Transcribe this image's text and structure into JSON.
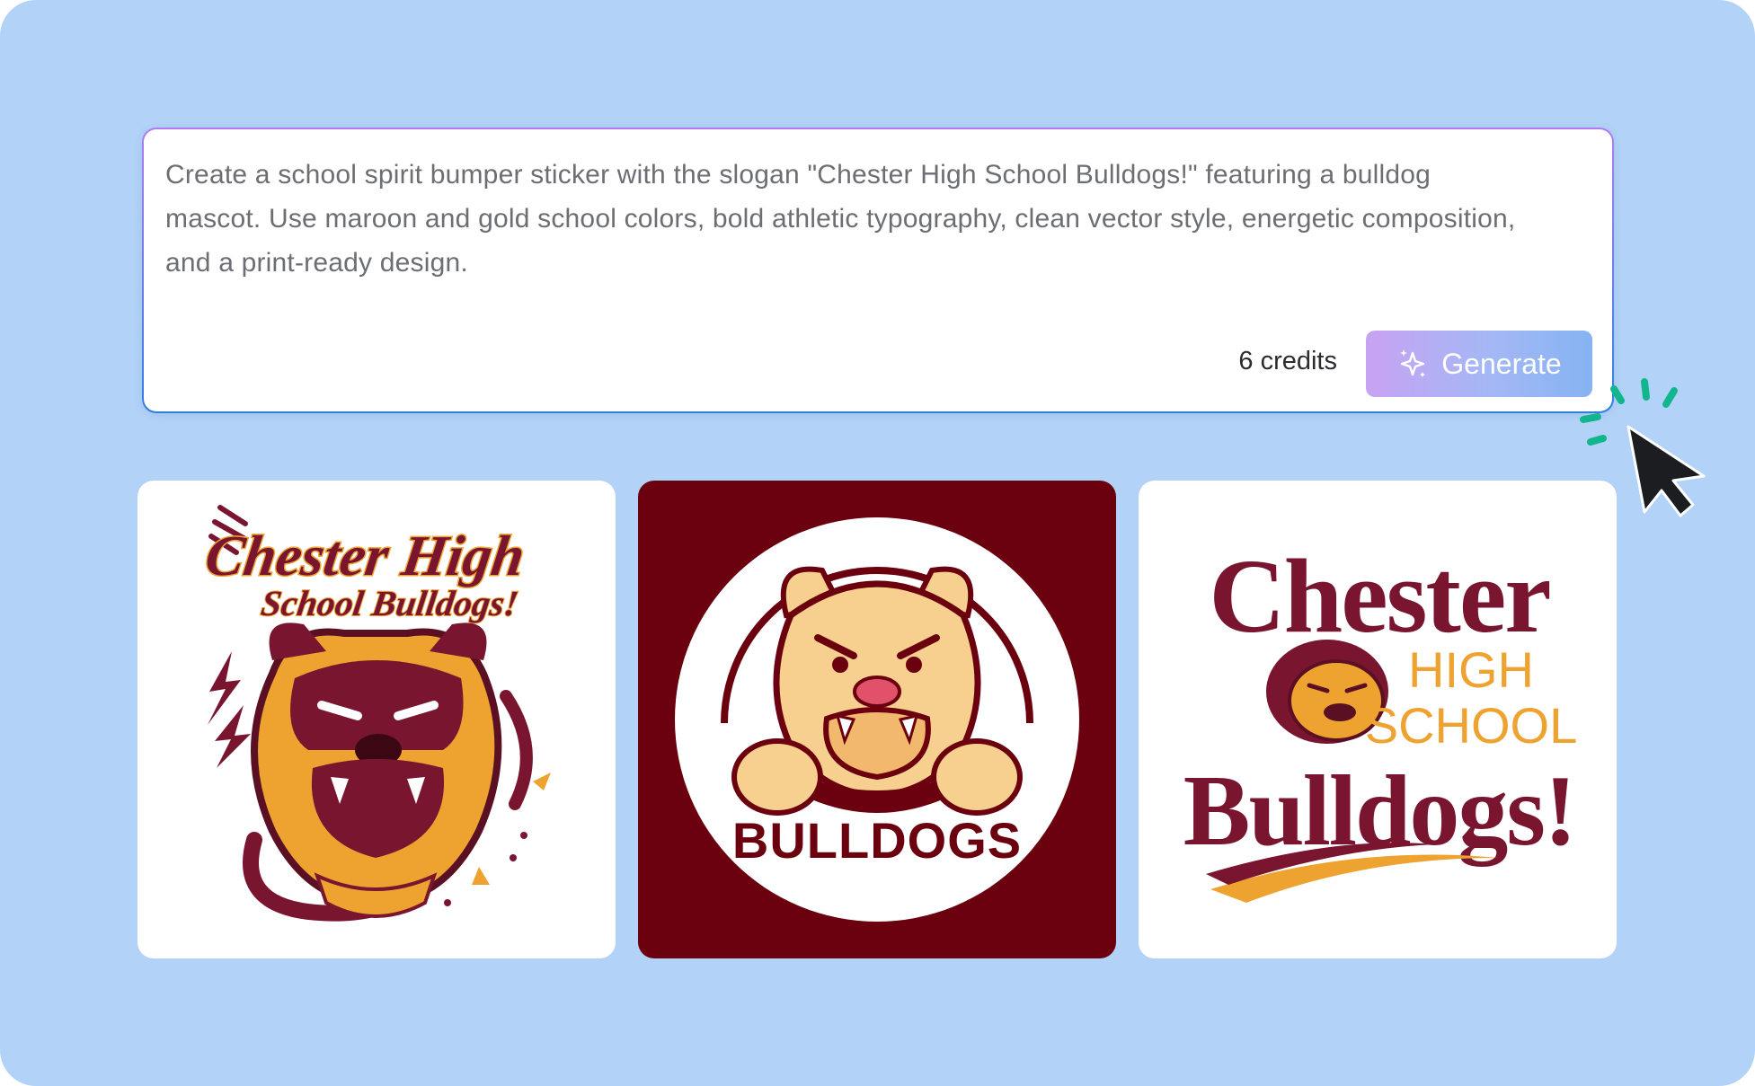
{
  "prompt": {
    "text": "Create a school spirit bumper sticker with the slogan \"Chester High School Bulldogs!\" featuring a bulldog mascot. Use maroon and gold school colors, bold athletic typography, clean vector style, energetic composition, and a print-ready design."
  },
  "generate": {
    "credits": "6 credits",
    "label": "Generate",
    "icon": "sparkles-icon"
  },
  "cursor": {
    "icon": "mouse-pointer-icon",
    "effect": "click-burst-icon"
  },
  "colors": {
    "background": "#b2d3f7",
    "maroon": "#7a1530",
    "dark_maroon": "#6b010f",
    "gold": "#eea230",
    "light_gold": "#f7cf8e",
    "click_burst": "#12b58d"
  },
  "results": [
    {
      "id": "result-1",
      "line1": "Chester High",
      "line2": "School Bulldogs!"
    },
    {
      "id": "result-2",
      "line1": "BULLDOGS"
    },
    {
      "id": "result-3",
      "line1": "Chester",
      "line2": "HIGH",
      "line3": "SCHOOL",
      "line4": "Bulldogs!"
    }
  ]
}
